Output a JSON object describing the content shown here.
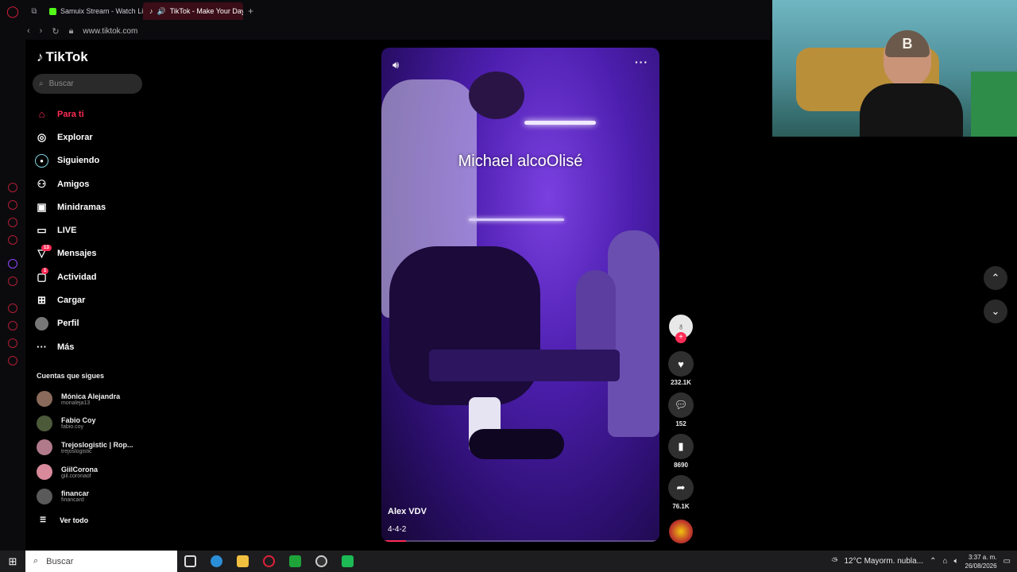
{
  "browser": {
    "tabs": [
      {
        "label": "Samuix Stream - Watch Live",
        "active": false,
        "color": "#53fc18"
      },
      {
        "label": "TikTok - Make Your Day",
        "active": true,
        "color": "#ffffff"
      }
    ],
    "url": "www.tiktok.com"
  },
  "sidebar": {
    "logo_text": "TikTok",
    "search_placeholder": "Buscar",
    "items": [
      {
        "label": "Para ti",
        "icon": "home-icon",
        "active": true
      },
      {
        "label": "Explorar",
        "icon": "compass-icon"
      },
      {
        "label": "Siguiendo",
        "icon": "following-icon"
      },
      {
        "label": "Amigos",
        "icon": "friends-icon"
      },
      {
        "label": "Minidramas",
        "icon": "film-icon"
      },
      {
        "label": "LIVE",
        "icon": "live-icon"
      },
      {
        "label": "Mensajes",
        "icon": "inbox-icon",
        "badge": "13"
      },
      {
        "label": "Actividad",
        "icon": "activity-icon",
        "badge": "1"
      },
      {
        "label": "Cargar",
        "icon": "upload-icon"
      },
      {
        "label": "Perfil",
        "icon": "profile-icon"
      },
      {
        "label": "Más",
        "icon": "more-icon"
      }
    ],
    "following_title": "Cuentas que sigues",
    "following": [
      {
        "name": "Mónica Alejandra ",
        "handle": "monaleja13"
      },
      {
        "name": "Fabio Coy",
        "handle": "fabio.coy"
      },
      {
        "name": "Trejoslogistic | Rop...",
        "handle": "trejoslogistic"
      },
      {
        "name": "GiilCorona",
        "handle": "giil.coronaof"
      },
      {
        "name": "financar",
        "handle": "financard"
      }
    ],
    "see_all": "Ver todo"
  },
  "video": {
    "caption": "Michael alcoOlisé",
    "author": "Alex VDV",
    "description": "4-4-2",
    "progress": 0.08
  },
  "actions": {
    "likes": "232.1K",
    "comments": "152",
    "saves": "8690",
    "shares": "76.1K"
  },
  "taskbar": {
    "search": "Buscar",
    "weather": "12°C  Mayorm. nubla...",
    "time": "3:37 a. m.",
    "date": "26/08/2026"
  }
}
